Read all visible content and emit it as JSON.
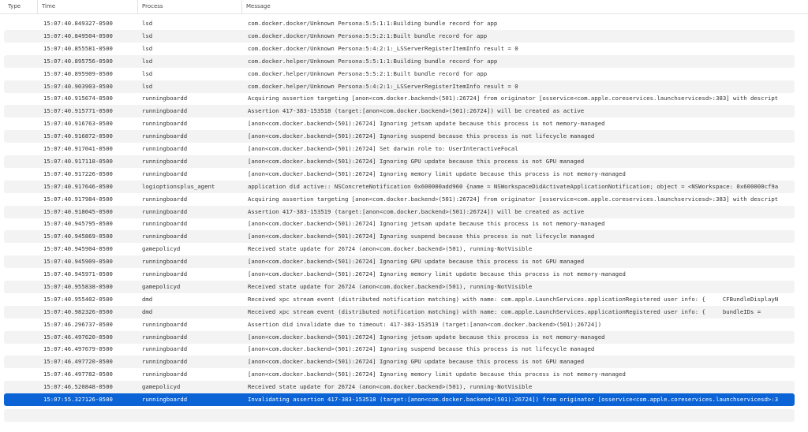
{
  "columns": {
    "type": "Type",
    "time": "Time",
    "process": "Process",
    "message": "Message"
  },
  "selected_index": 30,
  "rows": [
    {
      "time": "15:07:40.849327-0500",
      "process": "lsd",
      "message": "com.docker.docker/Unknown Persona:5:5:1:1:Building bundle record for app"
    },
    {
      "time": "15:07:40.849504-0500",
      "process": "lsd",
      "message": "com.docker.docker/Unknown Persona:5:5:2:1:Built bundle record for app"
    },
    {
      "time": "15:07:40.855581-0500",
      "process": "lsd",
      "message": "com.docker.docker/Unknown Persona:5:4:2:1:_LSServerRegisterItemInfo result = 0"
    },
    {
      "time": "15:07:40.895756-0500",
      "process": "lsd",
      "message": "com.docker.helper/Unknown Persona:5:5:1:1:Building bundle record for app"
    },
    {
      "time": "15:07:40.895909-0500",
      "process": "lsd",
      "message": "com.docker.helper/Unknown Persona:5:5:2:1:Built bundle record for app"
    },
    {
      "time": "15:07:40.903903-0500",
      "process": "lsd",
      "message": "com.docker.helper/Unknown Persona:5:4:2:1:_LSServerRegisterItemInfo result = 0"
    },
    {
      "time": "15:07:40.915674-0500",
      "process": "runningboardd",
      "message": "Acquiring assertion targeting [anon<com.docker.backend>(501):26724] from originator [osservice<com.apple.coreservices.launchservicesd>:383] with descript"
    },
    {
      "time": "15:07:40.915771-0500",
      "process": "runningboardd",
      "message": "Assertion 417-383-153518 (target:[anon<com.docker.backend>(501):26724]) will be created as active"
    },
    {
      "time": "15:07:40.916763-0500",
      "process": "runningboardd",
      "message": "[anon<com.docker.backend>(501):26724] Ignoring jetsam update because this process is not memory-managed"
    },
    {
      "time": "15:07:40.916872-0500",
      "process": "runningboardd",
      "message": "[anon<com.docker.backend>(501):26724] Ignoring suspend because this process is not lifecycle managed"
    },
    {
      "time": "15:07:40.917041-0500",
      "process": "runningboardd",
      "message": "[anon<com.docker.backend>(501):26724] Set darwin role to: UserInteractiveFocal"
    },
    {
      "time": "15:07:40.917118-0500",
      "process": "runningboardd",
      "message": "[anon<com.docker.backend>(501):26724] Ignoring GPU update because this process is not GPU managed"
    },
    {
      "time": "15:07:40.917226-0500",
      "process": "runningboardd",
      "message": "[anon<com.docker.backend>(501):26724] Ignoring memory limit update because this process is not memory-managed"
    },
    {
      "time": "15:07:40.917646-0500",
      "process": "logioptionsplus_agent",
      "message": "application did active:: NSConcreteNotification 0x600000add960 {name = NSWorkspaceDidActivateApplicationNotification; object = <NSWorkspace: 0x600000cf9a"
    },
    {
      "time": "15:07:40.917984-0500",
      "process": "runningboardd",
      "message": "Acquiring assertion targeting [anon<com.docker.backend>(501):26724] from originator [osservice<com.apple.coreservices.launchservicesd>:383] with descript"
    },
    {
      "time": "15:07:40.918045-0500",
      "process": "runningboardd",
      "message": "Assertion 417-383-153519 (target:[anon<com.docker.backend>(501):26724]) will be created as active"
    },
    {
      "time": "15:07:40.945795-0500",
      "process": "runningboardd",
      "message": "[anon<com.docker.backend>(501):26724] Ignoring jetsam update because this process is not memory-managed"
    },
    {
      "time": "15:07:40.945869-0500",
      "process": "runningboardd",
      "message": "[anon<com.docker.backend>(501):26724] Ignoring suspend because this process is not lifecycle managed"
    },
    {
      "time": "15:07:40.945904-0500",
      "process": "gamepolicyd",
      "message": "Received state update for 26724 (anon<com.docker.backend>(501), running-NotVisible"
    },
    {
      "time": "15:07:40.945909-0500",
      "process": "runningboardd",
      "message": "[anon<com.docker.backend>(501):26724] Ignoring GPU update because this process is not GPU managed"
    },
    {
      "time": "15:07:40.945971-0500",
      "process": "runningboardd",
      "message": "[anon<com.docker.backend>(501):26724] Ignoring memory limit update because this process is not memory-managed"
    },
    {
      "time": "15:07:40.955838-0500",
      "process": "gamepolicyd",
      "message": "Received state update for 26724 (anon<com.docker.backend>(501), running-NotVisible"
    },
    {
      "time": "15:07:40.955402-0500",
      "process": "dmd",
      "message": "Received xpc stream event (distributed notification matching) with name: com.apple.LaunchServices.applicationRegistered user info: {     CFBundleDisplayN"
    },
    {
      "time": "15:07:40.982326-0500",
      "process": "dmd",
      "message": "Received xpc stream event (distributed notification matching) with name: com.apple.LaunchServices.applicationRegistered user info: {     bundleIDs ="
    },
    {
      "time": "15:07:46.296737-0500",
      "process": "runningboardd",
      "message": "Assertion did invalidate due to timeout: 417-383-153519 (target:[anon<com.docker.backend>(501):26724])"
    },
    {
      "time": "15:07:46.497620-0500",
      "process": "runningboardd",
      "message": "[anon<com.docker.backend>(501):26724] Ignoring jetsam update because this process is not memory-managed"
    },
    {
      "time": "15:07:46.497679-0500",
      "process": "runningboardd",
      "message": "[anon<com.docker.backend>(501):26724] Ignoring suspend because this process is not lifecycle managed"
    },
    {
      "time": "15:07:46.497720-0500",
      "process": "runningboardd",
      "message": "[anon<com.docker.backend>(501):26724] Ignoring GPU update because this process is not GPU managed"
    },
    {
      "time": "15:07:46.497782-0500",
      "process": "runningboardd",
      "message": "[anon<com.docker.backend>(501):26724] Ignoring memory limit update because this process is not memory-managed"
    },
    {
      "time": "15:07:46.520848-0500",
      "process": "gamepolicyd",
      "message": "Received state update for 26724 (anon<com.docker.backend>(501), running-NotVisible"
    },
    {
      "time": "15:07:55.327126-0500",
      "process": "runningboardd",
      "message": "Invalidating assertion 417-383-153518 (target:[anon<com.docker.backend>(501):26724]) from originator [osservice<com.apple.coreservices.launchservicesd>:3"
    }
  ]
}
